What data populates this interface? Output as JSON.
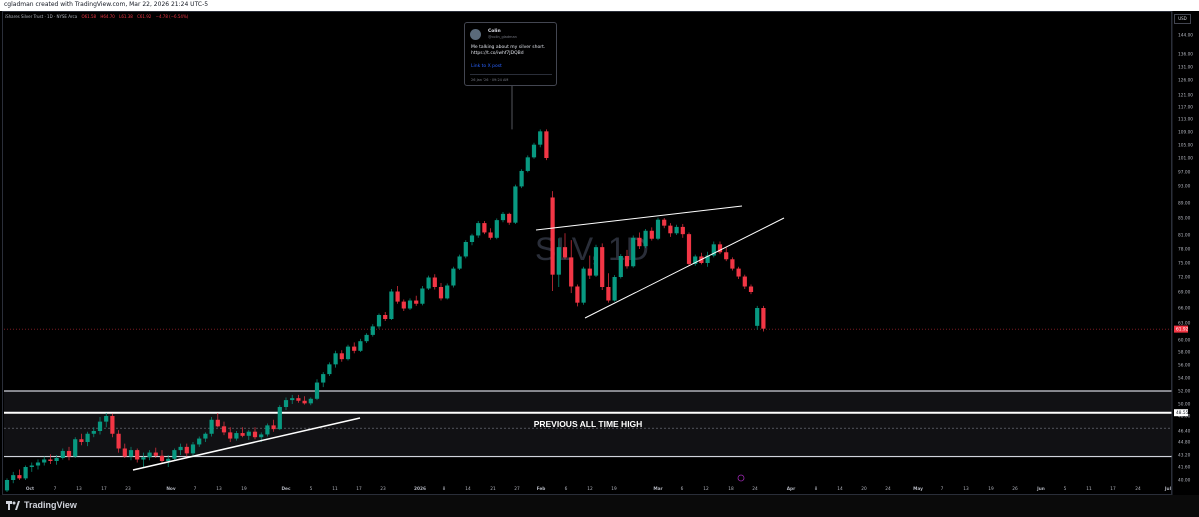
{
  "header": {
    "attribution": "cgladman created with TradingView.com, Mar 22, 2026 21:24 UTC-5"
  },
  "legend": {
    "instrument": "iShares Silver Trust · 1D · NYSE Arca",
    "open": "O61.58",
    "high": "H64.70",
    "low": "L61.38",
    "close": "C61.92",
    "change": "−4.78 (−6.54%)"
  },
  "currency": "USD",
  "watermark": "SLV, 1D",
  "annotation": {
    "label": "PREVIOUS ALL TIME HIGH"
  },
  "tweet": {
    "name": "Colin",
    "handle": "@colin_gladman",
    "text": "Me talking about my silver short. https://t.co/iwhf7JDQBd",
    "link": "Link to X post",
    "time": "26 Jan '26 · 09:24 AM"
  },
  "footer": {
    "brand": "TradingView"
  },
  "chart_data": {
    "type": "candlestick",
    "title": "SLV, 1D",
    "yaxis_ticks": [
      "144.00",
      "136.00",
      "131.00",
      "126.00",
      "121.00",
      "117.00",
      "113.00",
      "109.00",
      "105.00",
      "101.00",
      "97.00",
      "93.00",
      "89.00",
      "85.00",
      "81.00",
      "78.00",
      "75.00",
      "72.00",
      "69.00",
      "66.00",
      "63.00",
      "60.00",
      "58.00",
      "56.00",
      "54.00",
      "52.00",
      "50.00",
      "48.00",
      "46.40",
      "44.80",
      "43.20",
      "41.60",
      "40.00"
    ],
    "xaxis_ticks": [
      "Oct",
      "7",
      "13",
      "17",
      "23",
      "Nov",
      "7",
      "13",
      "19",
      "Dec",
      "5",
      "11",
      "17",
      "23",
      "2026",
      "8",
      "14",
      "21",
      "27",
      "Feb",
      "6",
      "12",
      "19",
      "Mar",
      "6",
      "12",
      "18",
      "24",
      "Apr",
      "8",
      "14",
      "20",
      "24",
      "May",
      "7",
      "13",
      "19",
      "26",
      "Jun",
      "5",
      "11",
      "17",
      "24",
      "Jul"
    ],
    "current_price": "61.92",
    "marked_price": "48.55",
    "ohlc_approx": [
      [
        38.7,
        40.2,
        38.5,
        40.0
      ],
      [
        40.0,
        41.0,
        39.6,
        40.6
      ],
      [
        40.6,
        41.3,
        40.0,
        40.2
      ],
      [
        40.2,
        41.8,
        40.0,
        41.6
      ],
      [
        41.6,
        42.2,
        41.0,
        41.8
      ],
      [
        41.8,
        42.6,
        41.3,
        42.2
      ],
      [
        42.2,
        43.0,
        41.8,
        42.6
      ],
      [
        42.6,
        43.3,
        42.0,
        42.4
      ],
      [
        42.4,
        43.2,
        41.9,
        42.8
      ],
      [
        42.8,
        44.0,
        42.6,
        43.7
      ],
      [
        43.7,
        44.2,
        42.5,
        43.0
      ],
      [
        43.0,
        45.5,
        42.8,
        45.2
      ],
      [
        45.2,
        46.0,
        44.4,
        44.8
      ],
      [
        44.8,
        46.3,
        44.3,
        46.0
      ],
      [
        46.0,
        46.8,
        45.5,
        46.4
      ],
      [
        46.4,
        47.9,
        45.9,
        47.4
      ],
      [
        47.4,
        48.5,
        46.8,
        48.0
      ],
      [
        48.0,
        48.4,
        45.5,
        46.0
      ],
      [
        46.0,
        46.5,
        43.5,
        44.0
      ],
      [
        44.0,
        44.6,
        42.8,
        43.0
      ],
      [
        43.0,
        44.2,
        42.5,
        43.8
      ],
      [
        43.8,
        44.0,
        42.2,
        42.6
      ],
      [
        42.6,
        43.5,
        41.5,
        42.9
      ],
      [
        42.9,
        43.8,
        42.5,
        43.5
      ],
      [
        43.5,
        44.1,
        42.8,
        43.1
      ],
      [
        43.1,
        43.8,
        42.0,
        42.4
      ],
      [
        42.4,
        43.2,
        41.6,
        42.7
      ],
      [
        42.7,
        44.0,
        42.5,
        43.8
      ],
      [
        43.8,
        44.6,
        43.2,
        44.2
      ],
      [
        44.2,
        44.6,
        43.0,
        43.4
      ],
      [
        43.4,
        44.8,
        43.0,
        44.5
      ],
      [
        44.5,
        45.6,
        44.2,
        45.3
      ],
      [
        45.3,
        46.2,
        44.8,
        46.0
      ],
      [
        46.0,
        47.9,
        45.6,
        47.6
      ],
      [
        47.6,
        48.5,
        46.8,
        46.9
      ],
      [
        46.9,
        47.4,
        45.8,
        46.2
      ],
      [
        46.2,
        46.8,
        44.8,
        45.3
      ],
      [
        45.3,
        46.4,
        45.0,
        46.1
      ],
      [
        46.1,
        46.8,
        45.5,
        45.7
      ],
      [
        45.7,
        46.5,
        45.1,
        46.3
      ],
      [
        46.3,
        46.8,
        45.2,
        45.5
      ],
      [
        45.5,
        46.2,
        44.8,
        45.9
      ],
      [
        45.9,
        47.2,
        45.6,
        47.0
      ],
      [
        47.0,
        47.6,
        46.3,
        46.6
      ],
      [
        46.6,
        49.8,
        46.5,
        49.5
      ],
      [
        49.5,
        51.0,
        49.0,
        50.6
      ],
      [
        50.6,
        51.4,
        50.0,
        50.9
      ],
      [
        50.9,
        51.4,
        50.2,
        50.5
      ],
      [
        50.5,
        51.2,
        49.9,
        50.1
      ],
      [
        50.1,
        51.0,
        49.8,
        50.8
      ],
      [
        50.8,
        53.8,
        50.6,
        53.3
      ],
      [
        53.3,
        54.9,
        52.6,
        54.6
      ],
      [
        54.6,
        56.4,
        54.3,
        56.1
      ],
      [
        56.1,
        58.2,
        55.6,
        57.8
      ],
      [
        57.8,
        58.3,
        56.5,
        56.9
      ],
      [
        56.9,
        59.2,
        56.7,
        58.9
      ],
      [
        58.9,
        59.6,
        57.8,
        58.2
      ],
      [
        58.2,
        60.2,
        58.0,
        59.8
      ],
      [
        59.8,
        61.2,
        59.5,
        60.9
      ],
      [
        60.9,
        62.8,
        60.6,
        62.4
      ],
      [
        62.4,
        64.9,
        62.0,
        64.6
      ],
      [
        64.6,
        65.2,
        63.4,
        63.8
      ],
      [
        63.8,
        69.6,
        63.6,
        69.1
      ],
      [
        69.1,
        70.2,
        66.8,
        67.2
      ],
      [
        67.2,
        67.6,
        65.4,
        65.9
      ],
      [
        65.9,
        67.8,
        65.6,
        67.4
      ],
      [
        67.4,
        68.3,
        66.4,
        66.8
      ],
      [
        66.8,
        70.2,
        66.5,
        69.7
      ],
      [
        69.7,
        72.3,
        69.4,
        71.9
      ],
      [
        71.9,
        72.6,
        69.5,
        70.0
      ],
      [
        70.0,
        70.8,
        67.4,
        67.8
      ],
      [
        67.8,
        70.7,
        67.6,
        70.3
      ],
      [
        70.3,
        74.2,
        69.9,
        73.8
      ],
      [
        73.8,
        76.8,
        73.5,
        76.4
      ],
      [
        76.4,
        79.9,
        76.0,
        79.5
      ],
      [
        79.5,
        81.3,
        78.8,
        80.9
      ],
      [
        80.9,
        84.3,
        80.4,
        83.8
      ],
      [
        83.8,
        84.3,
        81.2,
        81.6
      ],
      [
        81.6,
        82.6,
        80.0,
        80.4
      ],
      [
        80.4,
        84.9,
        80.1,
        84.5
      ],
      [
        84.5,
        86.6,
        84.0,
        86.1
      ],
      [
        86.1,
        86.4,
        83.4,
        83.9
      ],
      [
        83.9,
        93.4,
        83.6,
        92.9
      ],
      [
        92.9,
        97.8,
        92.5,
        97.3
      ],
      [
        97.3,
        101.8,
        96.9,
        101.2
      ],
      [
        101.2,
        105.7,
        100.8,
        105.1
      ],
      [
        105.1,
        109.8,
        104.3,
        109.2
      ],
      [
        109.2,
        109.8,
        100.4,
        101.0
      ],
      [
        90.3,
        91.8,
        69.2,
        72.5
      ],
      [
        72.5,
        80.3,
        70.0,
        78.4
      ],
      [
        78.4,
        81.4,
        75.8,
        76.2
      ],
      [
        76.2,
        79.9,
        68.8,
        70.1
      ],
      [
        70.1,
        70.5,
        66.3,
        67.0
      ],
      [
        67.0,
        74.2,
        66.6,
        73.8
      ],
      [
        73.8,
        76.6,
        71.6,
        72.3
      ],
      [
        72.3,
        78.9,
        72.0,
        78.4
      ],
      [
        78.4,
        79.2,
        69.4,
        70.0
      ],
      [
        70.0,
        72.8,
        67.0,
        67.4
      ],
      [
        67.4,
        72.4,
        67.2,
        72.0
      ],
      [
        72.0,
        76.9,
        71.7,
        76.5
      ],
      [
        76.5,
        77.8,
        73.8,
        74.3
      ],
      [
        74.3,
        80.9,
        74.0,
        80.4
      ],
      [
        80.4,
        81.6,
        78.0,
        78.6
      ],
      [
        78.6,
        82.4,
        78.2,
        82.0
      ],
      [
        82.0,
        82.8,
        79.8,
        80.2
      ],
      [
        80.2,
        85.1,
        79.9,
        84.6
      ],
      [
        84.6,
        85.0,
        82.6,
        83.2
      ],
      [
        83.2,
        83.8,
        80.6,
        81.4
      ],
      [
        81.4,
        83.4,
        81.0,
        82.9
      ],
      [
        82.9,
        83.6,
        80.4,
        81.2
      ],
      [
        81.2,
        81.6,
        74.4,
        74.8
      ],
      [
        74.8,
        76.8,
        74.4,
        76.4
      ],
      [
        76.4,
        77.2,
        74.7,
        75.0
      ],
      [
        75.0,
        77.4,
        74.2,
        76.6
      ],
      [
        76.6,
        79.6,
        76.2,
        79.0
      ],
      [
        79.0,
        79.6,
        76.9,
        77.3
      ],
      [
        77.3,
        78.3,
        75.4,
        75.8
      ],
      [
        75.8,
        76.2,
        73.4,
        73.8
      ],
      [
        73.8,
        74.2,
        71.6,
        72.1
      ],
      [
        72.1,
        72.5,
        69.6,
        70.1
      ],
      [
        70.1,
        70.5,
        68.6,
        69.0
      ],
      [
        62.5,
        66.4,
        61.8,
        66.0
      ],
      [
        66.0,
        66.4,
        61.5,
        62.0
      ]
    ]
  }
}
